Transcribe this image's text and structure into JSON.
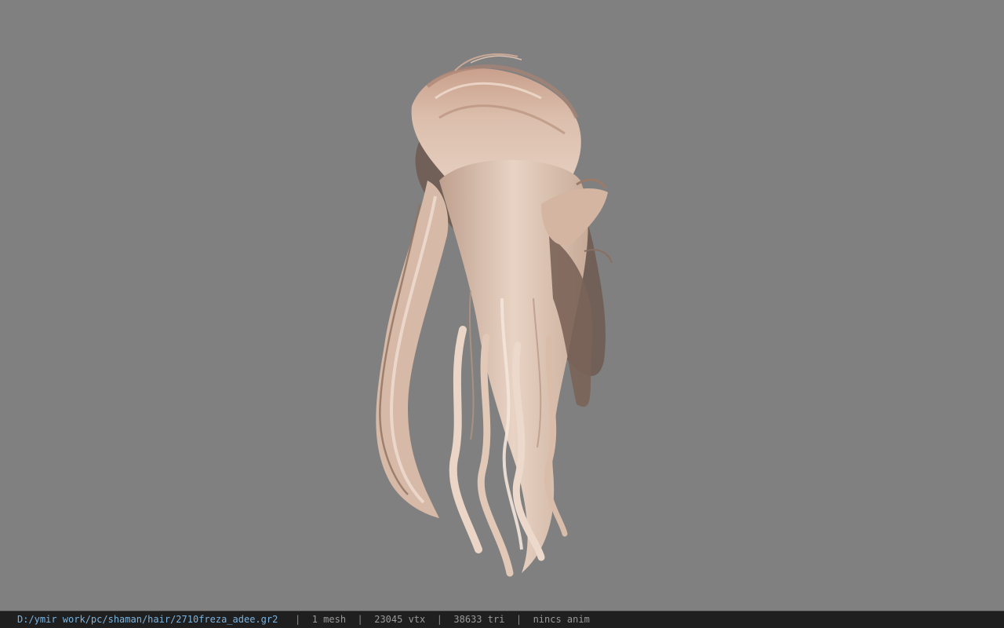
{
  "colors": {
    "viewport_background": "#808080",
    "statusbar_background": "#1f1f1f",
    "path_text": "#7ab4e0",
    "info_text": "#9a9a9a",
    "hair_light": "#e6cfbf",
    "hair_mid": "#cfae98",
    "hair_dark": "#6e5a50"
  },
  "statusbar": {
    "file_path": "D:/ymir work/pc/shaman/hair/2710freza_adee.gr2",
    "mesh_count": "1 mesh",
    "vertex_count": "23045 vtx",
    "triangle_count": "38633 tri",
    "animation_status": "nincs anim",
    "separator": "|"
  }
}
